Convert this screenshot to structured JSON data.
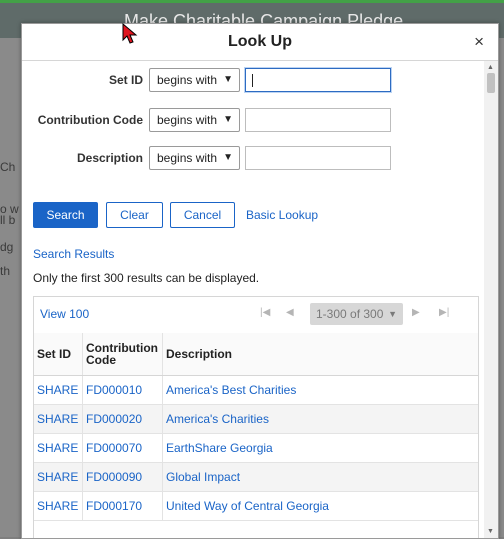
{
  "background": {
    "title": "Make Charitable Campaign Pledge",
    "fragments": [
      "Ch",
      "o w",
      "ll b",
      "dg",
      "th"
    ]
  },
  "modal": {
    "title": "Look Up",
    "close_label": "×"
  },
  "form": {
    "fields": [
      {
        "label": "Set ID",
        "operator": "begins with",
        "value": ""
      },
      {
        "label": "Contribution Code",
        "operator": "begins with",
        "value": ""
      },
      {
        "label": "Description",
        "operator": "begins with",
        "value": ""
      }
    ]
  },
  "buttons": {
    "search": "Search",
    "clear": "Clear",
    "cancel": "Cancel",
    "basic_lookup": "Basic Lookup"
  },
  "results": {
    "heading": "Search Results",
    "note": "Only the first 300 results can be displayed.",
    "view_link": "View 100",
    "range": "1-300 of 300",
    "columns": [
      "Set ID",
      "Contribution Code",
      "Description"
    ],
    "rows": [
      [
        "SHARE",
        "FD000010",
        "America's Best Charities"
      ],
      [
        "SHARE",
        "FD000020",
        "America's Charities"
      ],
      [
        "SHARE",
        "FD000070",
        "EarthShare Georgia"
      ],
      [
        "SHARE",
        "FD000090",
        "Global Impact"
      ],
      [
        "SHARE",
        "FD000170",
        "United Way of Central Georgia"
      ]
    ]
  }
}
